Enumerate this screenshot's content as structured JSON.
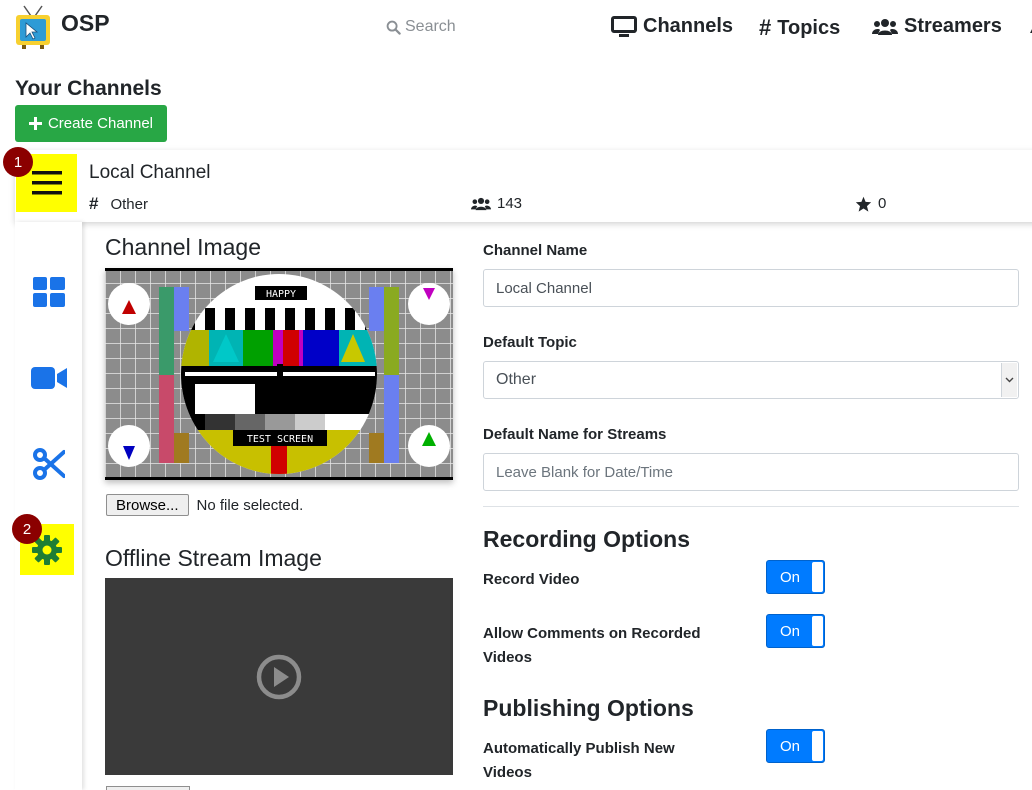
{
  "nav": {
    "brand": "OSP",
    "search_placeholder": "Search",
    "links": [
      "Channels",
      "Topics",
      "Streamers"
    ]
  },
  "page": {
    "heading": "Your Channels",
    "create_button": "Create Channel"
  },
  "channel": {
    "name": "Local Channel",
    "topic": "Other",
    "viewers": "143",
    "stars": "0"
  },
  "badges": [
    "1",
    "2"
  ],
  "sidebar": {
    "items": [
      "grid-icon",
      "video-camera-icon",
      "scissors-icon",
      "gear-icon"
    ]
  },
  "left": {
    "channel_image_title": "Channel Image",
    "browse_label": "Browse...",
    "no_file": "No file selected.",
    "offline_title": "Offline Stream Image",
    "test_card": {
      "top_label": "HAPPY",
      "bottom_label": "TEST SCREEN"
    }
  },
  "form": {
    "channel_name_label": "Channel Name",
    "channel_name_value": "Local Channel",
    "default_topic_label": "Default Topic",
    "default_topic_value": "Other",
    "default_stream_name_label": "Default Name for Streams",
    "default_stream_name_placeholder": "Leave Blank for Date/Time",
    "recording_heading": "Recording Options",
    "record_video_label": "Record Video",
    "record_video_state": "On",
    "allow_comments_label": "Allow Comments on Recorded Videos",
    "allow_comments_state": "On",
    "publishing_heading": "Publishing Options",
    "auto_publish_label": "Automatically Publish New Videos",
    "auto_publish_state": "On"
  },
  "colors": {
    "create_button": "#28a745",
    "toggle_on": "#007bff",
    "highlight": "#ffff00",
    "badge": "#8b0000",
    "sidebar_icon": "#1a73e8",
    "settings_icon": "#1e7e34"
  }
}
